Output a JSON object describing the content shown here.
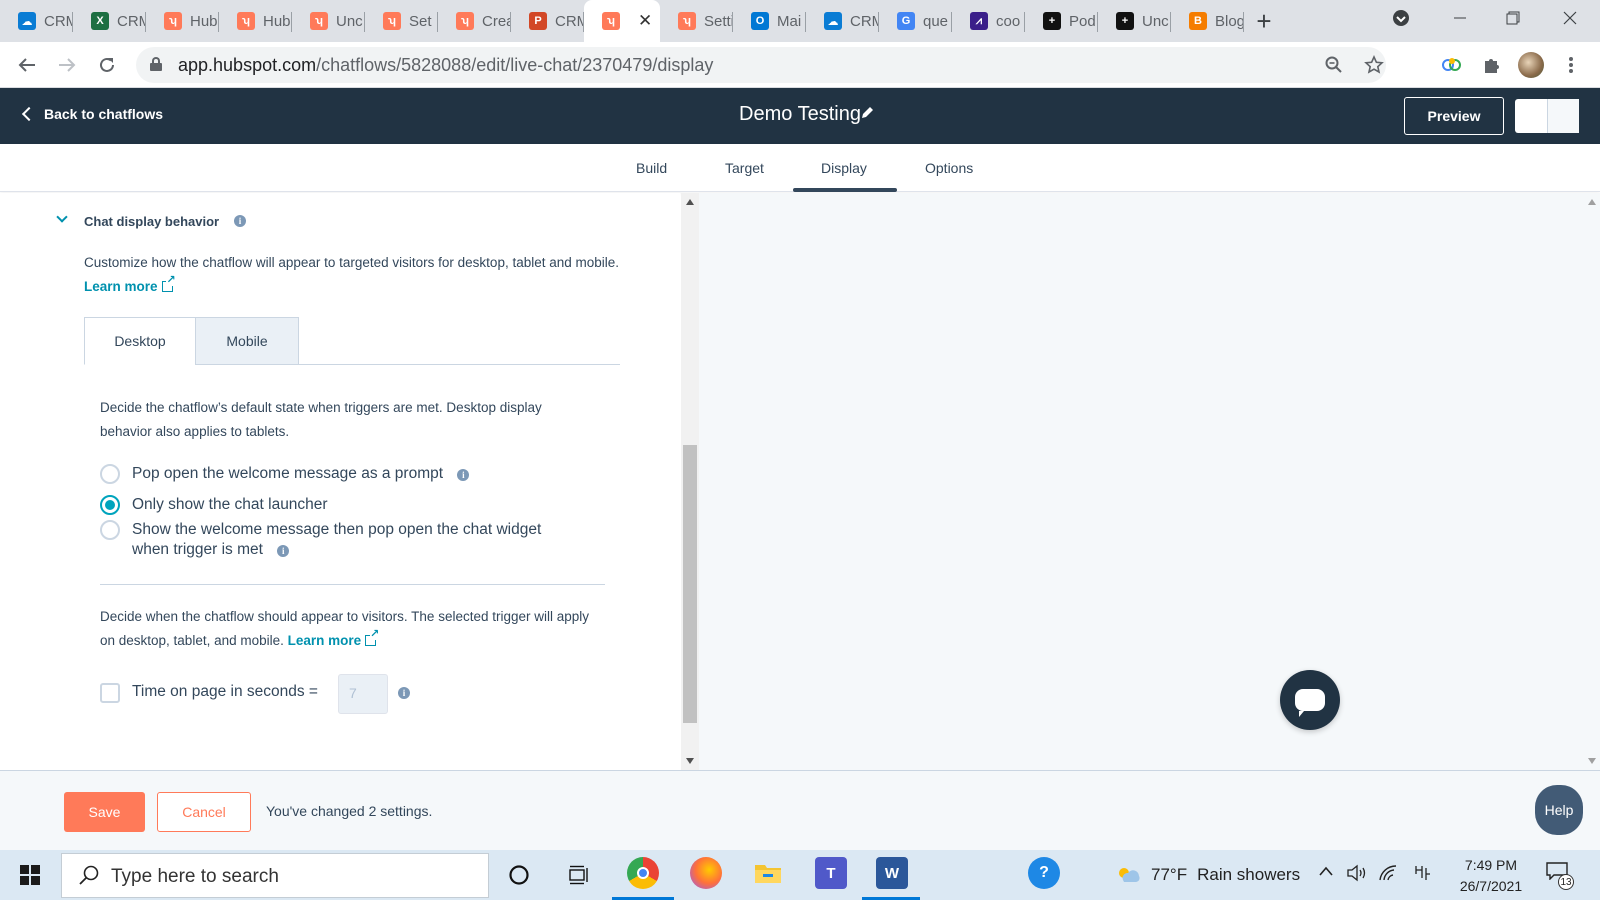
{
  "browser": {
    "tabs": [
      {
        "label": "CRM",
        "fav_color": "#0a7cd4",
        "fav_glyph": "☁"
      },
      {
        "label": "CRM",
        "fav_color": "#1d6f42",
        "fav_glyph": "X"
      },
      {
        "label": "Hub",
        "fav_color": "#ff7a59",
        "fav_glyph": "ʮ"
      },
      {
        "label": "Hub",
        "fav_color": "#ff7a59",
        "fav_glyph": "ʮ"
      },
      {
        "label": "Unc",
        "fav_color": "#ff7a59",
        "fav_glyph": "ʮ"
      },
      {
        "label": "Set",
        "fav_color": "#ff7a59",
        "fav_glyph": "ʮ"
      },
      {
        "label": "Crea",
        "fav_color": "#ff7a59",
        "fav_glyph": "ʮ"
      },
      {
        "label": "CRM",
        "fav_color": "#d24726",
        "fav_glyph": "P"
      },
      {
        "label": "",
        "fav_color": "#ff7a59",
        "fav_glyph": "ʮ",
        "active": true
      },
      {
        "label": "Setti",
        "fav_color": "#ff7a59",
        "fav_glyph": "ʮ"
      },
      {
        "label": "Mai",
        "fav_color": "#0078d4",
        "fav_glyph": "O"
      },
      {
        "label": "CRM",
        "fav_color": "#0a7cd4",
        "fav_glyph": "☁"
      },
      {
        "label": "que",
        "fav_color": "#4285f4",
        "fav_glyph": "G"
      },
      {
        "label": "coo",
        "fav_color": "#3b1f8a",
        "fav_glyph": "⩘"
      },
      {
        "label": "Pod",
        "fav_color": "#111111",
        "fav_glyph": "+"
      },
      {
        "label": "Unc",
        "fav_color": "#111111",
        "fav_glyph": "+"
      },
      {
        "label": "Blog",
        "fav_color": "#f57d00",
        "fav_glyph": "B"
      }
    ],
    "new_tab_glyph": "+",
    "url_host": "app.hubspot.com",
    "url_path": "/chatflows/5828088/edit/live-chat/2370479/display"
  },
  "hubspot": {
    "back_label": "Back to chatflows",
    "title": "Demo Testing",
    "preview_label": "Preview",
    "subtabs": [
      "Build",
      "Target",
      "Display",
      "Options"
    ],
    "active_subtab": "Display"
  },
  "section": {
    "title": "Chat display behavior",
    "intro": "Customize how the chatflow will appear to targeted visitors for desktop, tablet and mobile.",
    "learn_more": "Learn more",
    "device_tabs": [
      "Desktop",
      "Mobile"
    ],
    "default_state_text": "Decide the chatflow’s default state when triggers are met. Desktop display behavior also applies to tablets.",
    "options": [
      {
        "label": "Pop open the welcome message as a prompt",
        "checked": false,
        "has_info": true
      },
      {
        "label": "Only show the chat launcher",
        "checked": true,
        "has_info": false
      },
      {
        "label": "Show the welcome message then pop open the chat widget when trigger is met",
        "checked": false,
        "has_info": true
      }
    ],
    "trigger_text": "Decide when the chatflow should appear to visitors. The selected trigger will apply on desktop, tablet, and mobile.",
    "trigger_learn_more": "Learn more",
    "time_label": "Time on page in seconds =",
    "time_value": "7",
    "time_checked": false
  },
  "footer": {
    "save_label": "Save",
    "cancel_label": "Cancel",
    "changed_text": "You've changed 2 settings.",
    "help_label": "Help"
  },
  "taskbar": {
    "search_placeholder": "Type here to search",
    "weather_temp": "77°F",
    "weather_desc": "Rain showers",
    "time": "7:49 PM",
    "date": "26/7/2021",
    "notification_count": "13"
  },
  "colors": {
    "hubspot_header": "#213343",
    "accent_orange": "#ff7a59",
    "link_teal": "#0091ae",
    "radio_checked": "#00a4bd"
  }
}
